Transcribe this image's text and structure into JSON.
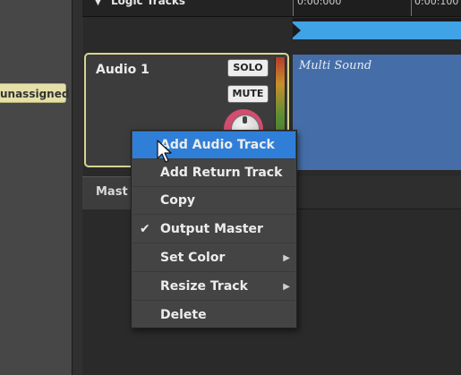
{
  "left_panel": {
    "unassigned_label": "unassigned"
  },
  "header": {
    "title": "Logic Tracks",
    "ruler_times": [
      "0:00:000",
      "0:00:100"
    ]
  },
  "track": {
    "name": "Audio 1",
    "solo_label": "SOLO",
    "mute_label": "MUTE",
    "clip_name": "Multi Sound"
  },
  "master": {
    "label": "Mast"
  },
  "context_menu": {
    "items": [
      {
        "label": "Add Audio Track",
        "highlighted": true
      },
      {
        "label": "Add Return Track"
      },
      {
        "label": "Copy"
      },
      {
        "label": "Output Master",
        "checked": true,
        "check_glyph": "✔"
      },
      {
        "label": "Set Color",
        "submenu_glyph": "▶"
      },
      {
        "label": "Resize Track",
        "submenu_glyph": "▶"
      },
      {
        "label": "Delete"
      }
    ]
  },
  "colors": {
    "accent_highlight": "#2f7fd9",
    "track_border": "#d7d690",
    "clip": "#456ea8",
    "loop_bar": "#3fa3e6",
    "knob_ring": "#d24d6e"
  }
}
